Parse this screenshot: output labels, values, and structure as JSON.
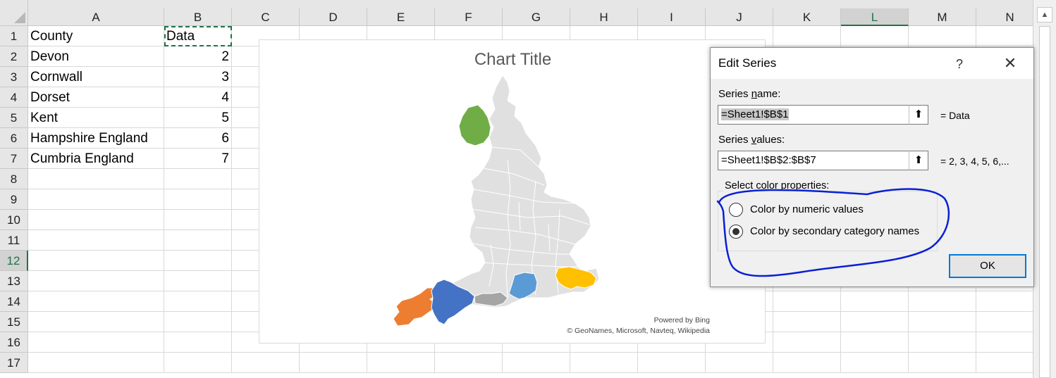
{
  "sheet": {
    "columns": [
      "A",
      "B",
      "C",
      "D",
      "E",
      "F",
      "G",
      "H",
      "I",
      "J",
      "K",
      "L",
      "M",
      "N"
    ],
    "selected_column": "L",
    "rows": [
      "1",
      "2",
      "3",
      "4",
      "5",
      "6",
      "7",
      "8",
      "9",
      "10",
      "11",
      "12",
      "13",
      "14",
      "15",
      "16",
      "17"
    ],
    "selected_row": "12",
    "cells": [
      {
        "a": "County",
        "b": "Data"
      },
      {
        "a": "Devon",
        "b": "2"
      },
      {
        "a": "Cornwall",
        "b": "3"
      },
      {
        "a": "Dorset",
        "b": "4"
      },
      {
        "a": "Kent",
        "b": "5"
      },
      {
        "a": "Hampshire England",
        "b": "6"
      },
      {
        "a": "Cumbria England",
        "b": "7"
      }
    ]
  },
  "chart": {
    "title": "Chart Title",
    "credit_line1": "Powered by Bing",
    "credit_line2": "© GeoNames, Microsoft, Navteq, Wikipedia",
    "colors": {
      "cumbria": "#70ad47",
      "cornwall": "#ed7d31",
      "devon": "#4472c4",
      "dorset": "#a5a5a5",
      "hampshire": "#5b9bd5",
      "kent": "#ffc000",
      "base": "#e0e0e0"
    }
  },
  "dialog": {
    "title": "Edit Series",
    "help": "?",
    "close": "✕",
    "series_name_label_pre": "Series ",
    "series_name_label_u": "n",
    "series_name_label_post": "ame:",
    "series_name_value": "=Sheet1!$B$1",
    "series_name_result": "= Data",
    "series_values_label_pre": "Series ",
    "series_values_label_u": "v",
    "series_values_label_post": "alues:",
    "series_values_value": "=Sheet1!$B$2:$B$7",
    "series_values_result": "= 2, 3, 4, 5, 6,...",
    "color_group_label": "Select color properties:",
    "option_numeric": "Color by numeric values",
    "option_category": "Color by secondary category names",
    "selected_option": "category",
    "ok_label": "OK"
  }
}
